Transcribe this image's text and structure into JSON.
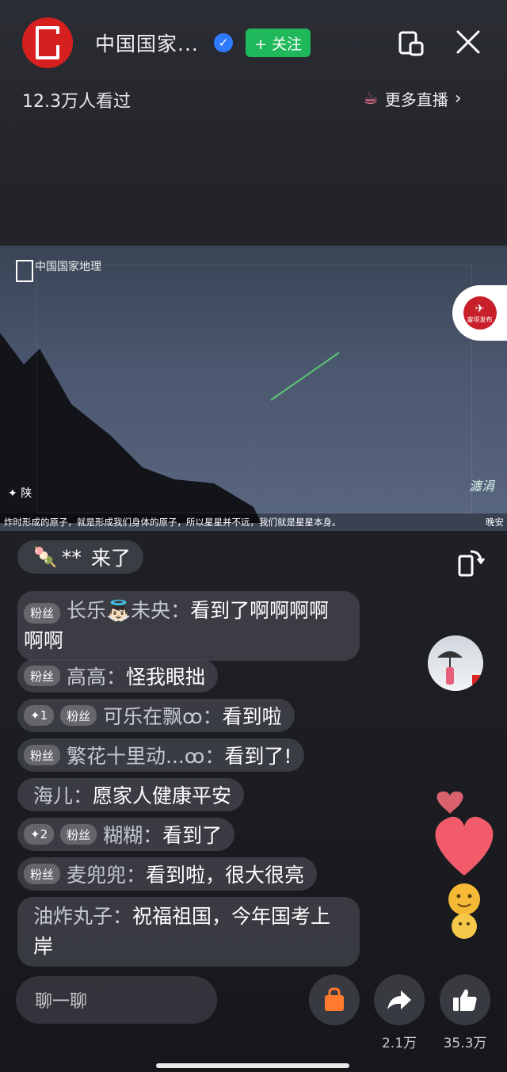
{
  "header": {
    "channel_name": "中国国家...",
    "follow_label": "+ 关注",
    "viewers": "12.3万人看过",
    "more_live_label": "更多直播"
  },
  "video": {
    "watermark_text": "中国国家地理",
    "corner_text": "陕",
    "script_watermark": "瀍涓",
    "subtitle": "炸时形成的原子，就是形成我们身体的原子，所以星星并不远，我们就是星星本身。",
    "subtitle_right": "晚安",
    "badge_text": "甯坝发布"
  },
  "chat": {
    "join_message": {
      "user": "**",
      "text": "来了"
    },
    "messages": [
      {
        "tags": [
          "粉丝"
        ],
        "user": "长乐👼🏻未央",
        "text": "看到了啊啊啊啊啊啊"
      },
      {
        "tags": [
          "粉丝"
        ],
        "user": "高高",
        "text": "怪我眼拙"
      },
      {
        "tags": [
          "✦1",
          "粉丝"
        ],
        "user": "可乐在飘ꝏ",
        "text": "看到啦"
      },
      {
        "tags": [
          "粉丝"
        ],
        "user": "繁花十里动...ꝏ",
        "text": "看到了!"
      },
      {
        "tags": [],
        "user": "海儿",
        "text": "愿家人健康平安"
      },
      {
        "tags": [
          "✦2",
          "粉丝"
        ],
        "user": "糊糊",
        "text": "看到了"
      },
      {
        "tags": [
          "粉丝"
        ],
        "user": "麦兜兜",
        "text": "看到啦，很大很亮"
      },
      {
        "tags": [],
        "user": "油炸丸子",
        "text": "祝福祖国，今年国考上岸"
      }
    ]
  },
  "bottom": {
    "input_placeholder": "聊一聊",
    "share_count": "2.1万",
    "like_count": "35.3万"
  },
  "colors": {
    "accent_follow": "#1fb85a",
    "logo_red": "#d62020",
    "shop_orange": "#ff7a2e"
  },
  "icons": [
    "logo-icon",
    "verified-icon",
    "screen-copy-icon",
    "close-icon",
    "cup-icon",
    "chevron-right-icon",
    "rotate-screen-icon",
    "shopping-bag-icon",
    "share-arrow-icon",
    "thumbs-up-icon"
  ]
}
